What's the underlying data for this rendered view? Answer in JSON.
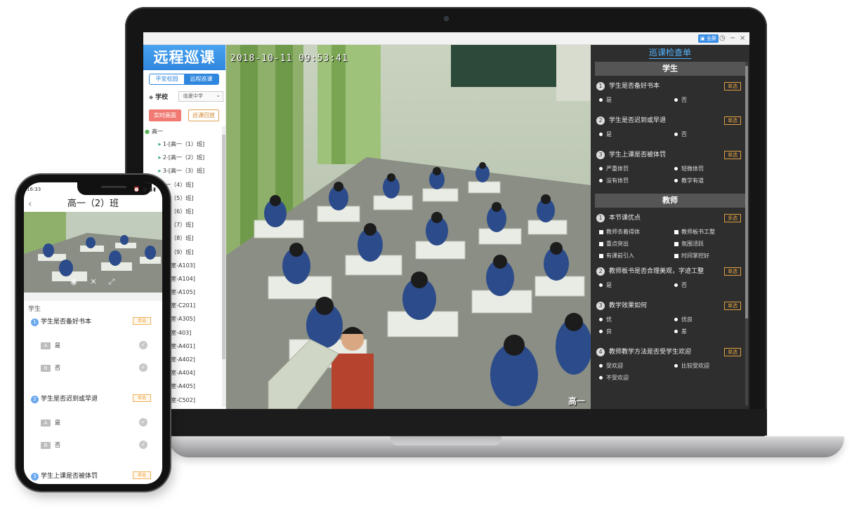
{
  "laptop": {
    "titlebar": {
      "badge": "▣ 全屏",
      "clock_icon": "clock-icon",
      "minimize": "−",
      "close": "×"
    },
    "sidebar": {
      "logo": "远程巡课",
      "segments": [
        "平安校园",
        "远程巡课"
      ],
      "active_segment": 1,
      "school_label": "学校",
      "school_value": "临夏中学",
      "live_button": "实时画面",
      "replay_button": "巡课回放",
      "tree_root": "高一",
      "tree_items": [
        "1-[高一（1）班]",
        "2-[高一（2）班]",
        "3-[高一（3）班]",
        "[高一（4）班]",
        "[高一（5）班]",
        "[高一（6）班]",
        "[高一（7）班]",
        "[高一（8）班]",
        "[高一（9）班]",
        "[空教室-A103]",
        "[空教室-A104]",
        "[空教室-A105]",
        "[空教室-C201]",
        "[空教室-A305]",
        "[空教室-403]",
        "[空教室-A401]",
        "[空教室-A402]",
        "[空教室-A404]",
        "[空教室-A405]",
        "[空教室-C502]"
      ]
    },
    "video": {
      "timestamp": "2018-10-11 09:53:41",
      "label": "高一"
    },
    "checklist": {
      "title": "巡课检查单",
      "sections": [
        {
          "name": "学生",
          "questions": [
            {
              "num": "1",
              "text": "学生是否备好书本",
              "tag": "单选",
              "options": [
                "是",
                "否"
              ],
              "kind": "radio"
            },
            {
              "num": "2",
              "text": "学生是否迟到或早退",
              "tag": "单选",
              "options": [
                "是",
                "否"
              ],
              "kind": "radio"
            },
            {
              "num": "3",
              "text": "学生上课是否被体罚",
              "tag": "单选",
              "options": [
                "严重体罚",
                "轻微体罚",
                "没有体罚",
                "教学有道"
              ],
              "kind": "radio"
            }
          ]
        },
        {
          "name": "教师",
          "questions": [
            {
              "num": "1",
              "text": "本节课优点",
              "tag": "多选",
              "options": [
                "教师衣着得体",
                "教师板书工整",
                "重点突出",
                "氛围活跃",
                "有课前引入",
                "时间掌控好"
              ],
              "kind": "checkbox"
            },
            {
              "num": "2",
              "text": "教师板书是否合理美观，字迹工整",
              "tag": "单选",
              "options": [
                "是",
                "否"
              ],
              "kind": "radio"
            },
            {
              "num": "3",
              "text": "教学效果如何",
              "tag": "单选",
              "options": [
                "优",
                "优良",
                "良",
                "差"
              ],
              "kind": "radio"
            },
            {
              "num": "4",
              "text": "教师教学方法是否受学生欢迎",
              "tag": "单选",
              "options": [
                "受欢迎",
                "比较受欢迎",
                "不受欢迎"
              ],
              "kind": "radio"
            }
          ]
        }
      ]
    }
  },
  "phone": {
    "status_time": "16:33",
    "status_icons": "⏰ ◎ ▮▮",
    "title": "高一（2）班",
    "section_label": "学生",
    "questions": [
      {
        "num": "1",
        "text": "学生是否备好书本",
        "tag": "单选",
        "options": [
          {
            "key": "A",
            "label": "是"
          },
          {
            "key": "B",
            "label": "否"
          }
        ]
      },
      {
        "num": "2",
        "text": "学生是否迟到或早退",
        "tag": "单选",
        "options": [
          {
            "key": "A",
            "label": "是"
          },
          {
            "key": "B",
            "label": "否"
          }
        ]
      },
      {
        "num": "3",
        "text": "学生上课是否被体罚",
        "tag": "单选",
        "options": []
      }
    ]
  }
}
